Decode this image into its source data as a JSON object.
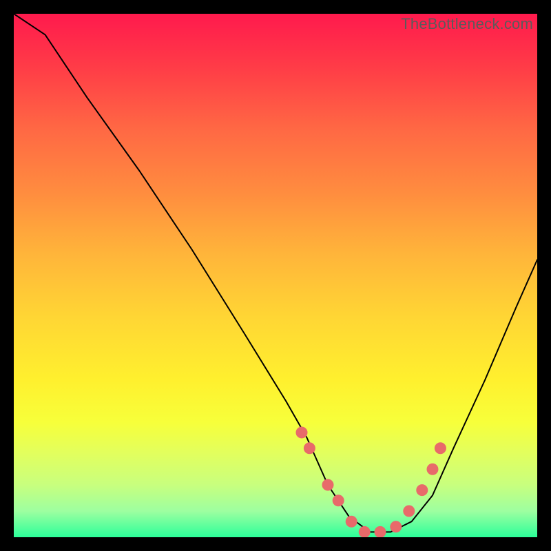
{
  "watermark": "TheBottleneck.com",
  "colors": {
    "frame": "#000000",
    "curve": "#000000",
    "dot": "#e86a6a",
    "gradient_top": "#ff1a4d",
    "gradient_bottom": "#2bff9a"
  },
  "chart_data": {
    "type": "line",
    "title": "",
    "xlabel": "",
    "ylabel": "",
    "xlim": [
      0,
      100
    ],
    "ylim": [
      0,
      100
    ],
    "series": [
      {
        "name": "bottleneck-curve",
        "x": [
          0,
          6,
          14,
          24,
          34,
          44,
          52,
          56,
          60,
          64,
          68,
          72,
          76,
          80,
          84,
          90,
          96,
          100
        ],
        "values": [
          100,
          96,
          84,
          70,
          55,
          39,
          26,
          19,
          10,
          4,
          1,
          1,
          3,
          8,
          17,
          30,
          44,
          53
        ]
      }
    ],
    "markers": {
      "name": "highlight-points",
      "x": [
        55,
        56.5,
        60,
        62,
        64.5,
        67,
        70,
        73,
        75.5,
        78,
        80,
        81.5
      ],
      "values": [
        20,
        17,
        10,
        7,
        3,
        1,
        1,
        2,
        5,
        9,
        13,
        17
      ]
    }
  }
}
